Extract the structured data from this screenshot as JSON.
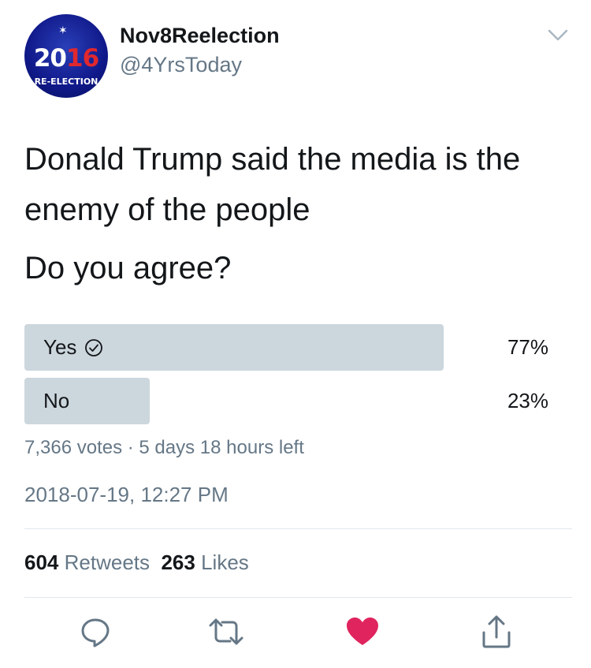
{
  "user": {
    "name": "Nov8Reelection",
    "handle": "@4YrsToday",
    "avatar_year": "2016",
    "avatar_caption": "RE-ELECTION"
  },
  "tweet": {
    "text": "Donald Trump said the media is the enemy of the people",
    "question": "Do you agree?"
  },
  "poll": {
    "options": [
      {
        "label": "Yes",
        "percent_text": "77%",
        "percent": 77,
        "selected": true
      },
      {
        "label": "No",
        "percent_text": "23%",
        "percent": 23,
        "selected": false
      }
    ],
    "meta": "7,366 votes · 5 days 18 hours left"
  },
  "timestamp": "2018-07-19, 12:27 PM",
  "stats": {
    "retweets_count": "604",
    "retweets_label": "Retweets",
    "likes_count": "263",
    "likes_label": "Likes"
  },
  "actions": [
    {
      "icon": "reply-icon"
    },
    {
      "icon": "retweet-icon"
    },
    {
      "icon": "like-icon",
      "color": "#e0245e"
    },
    {
      "icon": "share-icon"
    }
  ],
  "colors": {
    "text": "#14171a",
    "secondary": "#657786",
    "poll_bar": "#ccd6dd",
    "like": "#e0245e",
    "divider": "#e1e8ed"
  }
}
